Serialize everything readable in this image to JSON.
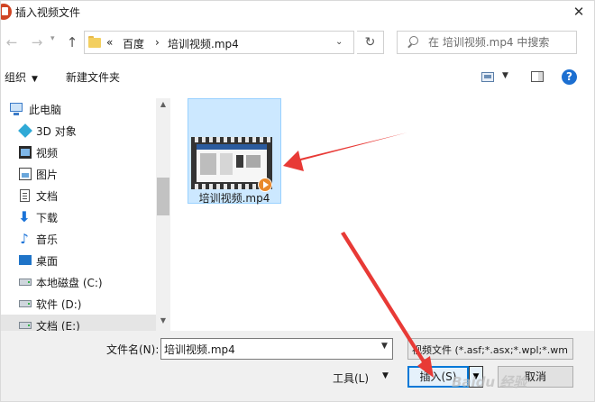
{
  "window": {
    "title": "插入视频文件",
    "close_glyph": "✕"
  },
  "nav": {
    "back_glyph": "←",
    "forward_glyph": "→",
    "recent_glyph": "▾",
    "up_glyph": "↑",
    "breadcrumb_prefix": "«",
    "breadcrumb": [
      "百度",
      "培训视频.mp4"
    ],
    "crumb_sep": "›",
    "address_drop_glyph": "⌄",
    "refresh_glyph": "↻",
    "search_placeholder": "在 培训视频.mp4 中搜索"
  },
  "toolbar": {
    "organize_label": "组织",
    "caret_glyph": "▼",
    "new_folder_label": "新建文件夹",
    "help_glyph": "?"
  },
  "sidebar": {
    "items": [
      {
        "label": "此电脑",
        "icon": "computer-icon"
      },
      {
        "label": "3D 对象",
        "icon": "3d-objects-icon"
      },
      {
        "label": "视频",
        "icon": "video-folder-icon"
      },
      {
        "label": "图片",
        "icon": "pictures-icon"
      },
      {
        "label": "文档",
        "icon": "documents-icon"
      },
      {
        "label": "下载",
        "icon": "download-icon"
      },
      {
        "label": "音乐",
        "icon": "music-icon"
      },
      {
        "label": "桌面",
        "icon": "desktop-icon"
      },
      {
        "label": "本地磁盘 (C:)",
        "icon": "drive-icon"
      },
      {
        "label": "软件 (D:)",
        "icon": "drive-icon"
      },
      {
        "label": "文档 (E:)",
        "icon": "drive-icon"
      }
    ],
    "download_glyph": "⬇",
    "music_glyph": "♪",
    "scroll_up_glyph": "▲",
    "scroll_down_glyph": "▼"
  },
  "content": {
    "files": [
      {
        "name": "培训视频.mp4",
        "icon": "video-file-icon"
      }
    ]
  },
  "bottom": {
    "filename_label": "文件名(N):",
    "filename_value": "培训视频.mp4",
    "drop_glyph": "▼",
    "filetype_value": "视频文件 (*.asf;*.asx;*.wpl;*.wm",
    "tools_label": "工具(L)",
    "insert_label": "插入(S)",
    "insert_drop_glyph": "▼",
    "cancel_label": "取消"
  },
  "watermark": "Baidu 经验",
  "colors": {
    "accent": "#0078d7",
    "selection": "#cce8ff",
    "annotation_arrow": "#e83a36"
  }
}
